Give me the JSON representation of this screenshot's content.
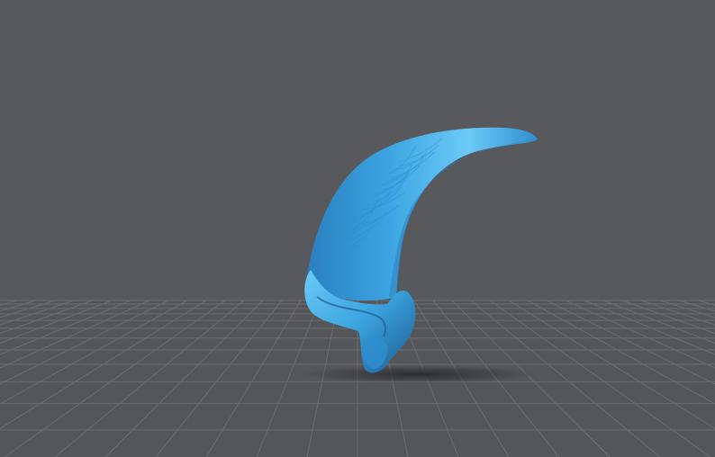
{
  "viewport": {
    "background_color": "#58595c",
    "floor_color": "#55565a",
    "grid_line_color": "#6c6d71",
    "model": {
      "name": "claw",
      "icon": "claw-3d-model",
      "color": "#3ba4e0",
      "highlight_color": "#6ccaf7",
      "shadow_color": "#1c5a8e"
    },
    "ground_shadow_color": "#2a2b2e"
  }
}
